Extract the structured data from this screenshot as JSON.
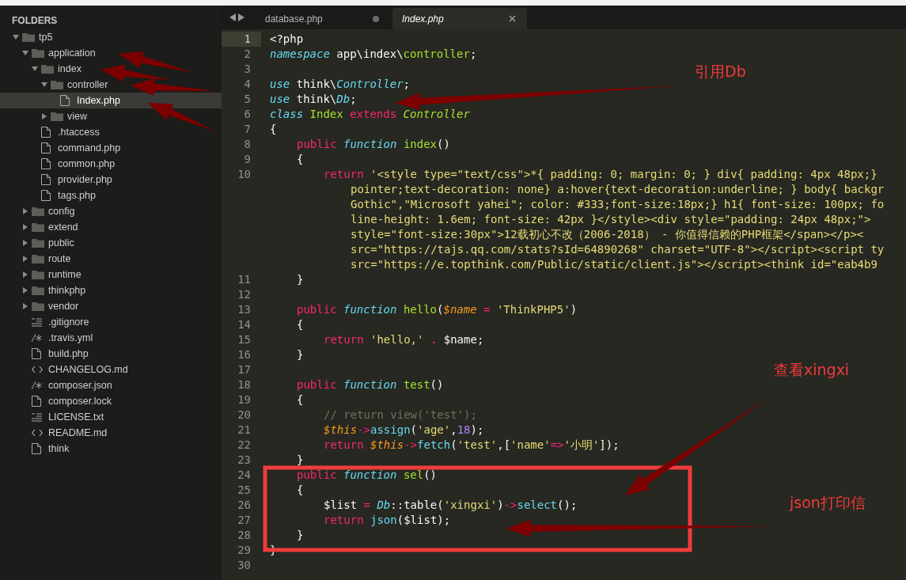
{
  "sidebar": {
    "header": "FOLDERS",
    "items": [
      {
        "label": "tp5",
        "kind": "folder",
        "expanded": true,
        "selected": false,
        "children": [
          {
            "label": "application",
            "kind": "folder",
            "expanded": true,
            "selected": false,
            "children": [
              {
                "label": "index",
                "kind": "folder",
                "expanded": true,
                "selected": false,
                "children": [
                  {
                    "label": "controller",
                    "kind": "folder",
                    "expanded": true,
                    "selected": false,
                    "children": [
                      {
                        "label": "Index.php",
                        "kind": "file",
                        "selected": true
                      }
                    ]
                  },
                  {
                    "label": "view",
                    "kind": "folder",
                    "expanded": false,
                    "selected": false
                  }
                ]
              },
              {
                "label": ".htaccess",
                "kind": "file",
                "selected": false
              },
              {
                "label": "command.php",
                "kind": "file",
                "selected": false
              },
              {
                "label": "common.php",
                "kind": "file",
                "selected": false
              },
              {
                "label": "provider.php",
                "kind": "file",
                "selected": false
              },
              {
                "label": "tags.php",
                "kind": "file",
                "selected": false
              }
            ]
          },
          {
            "label": "config",
            "kind": "folder",
            "expanded": false,
            "selected": false
          },
          {
            "label": "extend",
            "kind": "folder",
            "expanded": false,
            "selected": false
          },
          {
            "label": "public",
            "kind": "folder",
            "expanded": false,
            "selected": false
          },
          {
            "label": "route",
            "kind": "folder",
            "expanded": false,
            "selected": false
          },
          {
            "label": "runtime",
            "kind": "folder",
            "expanded": false,
            "selected": false
          },
          {
            "label": "thinkphp",
            "kind": "folder",
            "expanded": false,
            "selected": false
          },
          {
            "label": "vendor",
            "kind": "folder",
            "expanded": false,
            "selected": false
          },
          {
            "label": ".gitignore",
            "kind": "text",
            "selected": false
          },
          {
            "label": ".travis.yml",
            "kind": "comment",
            "selected": false
          },
          {
            "label": "build.php",
            "kind": "file",
            "selected": false
          },
          {
            "label": "CHANGELOG.md",
            "kind": "markup",
            "selected": false
          },
          {
            "label": "composer.json",
            "kind": "comment",
            "selected": false
          },
          {
            "label": "composer.lock",
            "kind": "file",
            "selected": false
          },
          {
            "label": "LICENSE.txt",
            "kind": "text",
            "selected": false
          },
          {
            "label": "README.md",
            "kind": "markup",
            "selected": false
          },
          {
            "label": "think",
            "kind": "file",
            "selected": false
          }
        ]
      }
    ]
  },
  "tabs": [
    {
      "label": "database.php",
      "selected": false,
      "modified": true
    },
    {
      "label": "Index.php",
      "selected": true,
      "modified": false
    }
  ],
  "editor": {
    "lines": [
      {
        "number": "1",
        "current": true,
        "kind": "top",
        "segments": [
          {
            "kind": "plain",
            "text": "<?php"
          }
        ]
      },
      {
        "number": "2",
        "current": false,
        "kind": "top",
        "segments": [
          {
            "kind": "storage",
            "text": "namespace "
          },
          {
            "kind": "plain",
            "text": "app\\index\\"
          },
          {
            "kind": "entity",
            "text": "controller"
          },
          {
            "kind": "plain",
            "text": ";"
          }
        ]
      },
      {
        "number": "3",
        "current": false
      },
      {
        "number": "4",
        "current": false,
        "kind": "top",
        "segments": [
          {
            "kind": "storage",
            "text": "use "
          },
          {
            "kind": "plain",
            "text": "think\\"
          },
          {
            "kind": "support_italic",
            "text": "Controller"
          },
          {
            "kind": "plain",
            "text": ";"
          }
        ]
      },
      {
        "number": "5",
        "current": false,
        "kind": "top",
        "segments": [
          {
            "kind": "storage",
            "text": "use "
          },
          {
            "kind": "plain",
            "text": "think\\"
          },
          {
            "kind": "support_italic",
            "text": "Db"
          },
          {
            "kind": "plain",
            "text": ";"
          }
        ]
      },
      {
        "number": "6",
        "current": false,
        "kind": "top",
        "segments": [
          {
            "kind": "storage",
            "text": "class "
          },
          {
            "kind": "entity",
            "text": "Index "
          },
          {
            "kind": "keyword",
            "text": "extends "
          },
          {
            "kind": "inherited",
            "text": "Controller"
          }
        ]
      },
      {
        "number": "7",
        "current": false,
        "kind": "top",
        "segments": [
          {
            "kind": "plain",
            "text": "{"
          }
        ]
      },
      {
        "number": "8",
        "current": false,
        "kind": "method",
        "segments": [
          {
            "kind": "keyword",
            "text": "public "
          },
          {
            "kind": "storage",
            "text": "function "
          },
          {
            "kind": "entity",
            "text": "index"
          },
          {
            "kind": "plain",
            "text": "()"
          }
        ]
      },
      {
        "number": "9",
        "current": false,
        "kind": "method",
        "segments": [
          {
            "kind": "plain",
            "text": "{"
          }
        ]
      },
      {
        "number": "10",
        "current": false,
        "kind": "statement",
        "segments": [
          {
            "kind": "keyword",
            "text": "return "
          },
          {
            "kind": "string",
            "text": "'<style type=\"text/css\">*{ padding: 0; margin: 0; } div{ padding: 4px 48px;}"
          }
        ],
        "wrapped": [
          [
            {
              "kind": "string",
              "text": "pointer;text-decoration: none} a:hover{text-decoration:underline; } body{ backgr"
            }
          ],
          [
            {
              "kind": "string",
              "text": "Gothic\",\"Microsoft yahei\"; color: #333;font-size:18px;} h1{ font-size: 100px; fo"
            }
          ],
          [
            {
              "kind": "string",
              "text": "line-height: 1.6em; font-size: 42px }</style><div style=\"padding: 24px 48px;\">"
            }
          ],
          [
            {
              "kind": "string",
              "text": "style=\"font-size:30px\">12载初心不改（2006-2018） - 你值得信赖的PHP框架</span></p><"
            }
          ],
          [
            {
              "kind": "string",
              "text": "src=\"https://tajs.qq.com/stats?sId=64890268\" charset=\"UTF-8\"></script><script ty"
            }
          ],
          [
            {
              "kind": "string",
              "text": "src=\"https://e.topthink.com/Public/static/client.js\"></script><think id=\"eab4b9"
            }
          ]
        ]
      },
      {
        "number": "11",
        "current": false,
        "kind": "method",
        "segments": [
          {
            "kind": "plain",
            "text": "}"
          }
        ]
      },
      {
        "number": "12",
        "current": false
      },
      {
        "number": "13",
        "current": false,
        "kind": "method",
        "segments": [
          {
            "kind": "keyword",
            "text": "public "
          },
          {
            "kind": "storage",
            "text": "function "
          },
          {
            "kind": "entity",
            "text": "hello"
          },
          {
            "kind": "plain",
            "text": "("
          },
          {
            "kind": "variable",
            "text": "$name "
          },
          {
            "kind": "keyword",
            "text": "= "
          },
          {
            "kind": "string",
            "text": "'ThinkPHP5'"
          },
          {
            "kind": "plain",
            "text": ")"
          }
        ]
      },
      {
        "number": "14",
        "current": false,
        "kind": "method",
        "segments": [
          {
            "kind": "plain",
            "text": "{"
          }
        ]
      },
      {
        "number": "15",
        "current": false,
        "kind": "statement",
        "segments": [
          {
            "kind": "keyword",
            "text": "return "
          },
          {
            "kind": "string",
            "text": "'hello,' "
          },
          {
            "kind": "keyword",
            "text": ". "
          },
          {
            "kind": "plain",
            "text": "$name;"
          }
        ]
      },
      {
        "number": "16",
        "current": false,
        "kind": "method",
        "segments": [
          {
            "kind": "plain",
            "text": "}"
          }
        ]
      },
      {
        "number": "17",
        "current": false
      },
      {
        "number": "18",
        "current": false,
        "kind": "method",
        "segments": [
          {
            "kind": "keyword",
            "text": "public "
          },
          {
            "kind": "storage",
            "text": "function "
          },
          {
            "kind": "entity",
            "text": "test"
          },
          {
            "kind": "plain",
            "text": "()"
          }
        ]
      },
      {
        "number": "19",
        "current": false,
        "kind": "method",
        "segments": [
          {
            "kind": "plain",
            "text": "{"
          }
        ]
      },
      {
        "number": "20",
        "current": false,
        "kind": "statement",
        "segments": [
          {
            "kind": "comment",
            "text": "// return view('test');"
          }
        ]
      },
      {
        "number": "21",
        "current": false,
        "kind": "statement",
        "segments": [
          {
            "kind": "variable",
            "text": "$this"
          },
          {
            "kind": "keyword",
            "text": "->"
          },
          {
            "kind": "support",
            "text": "assign"
          },
          {
            "kind": "plain",
            "text": "("
          },
          {
            "kind": "string",
            "text": "'age'"
          },
          {
            "kind": "plain",
            "text": ","
          },
          {
            "kind": "number",
            "text": "18"
          },
          {
            "kind": "plain",
            "text": ");"
          }
        ]
      },
      {
        "number": "22",
        "current": false,
        "kind": "statement",
        "segments": [
          {
            "kind": "keyword",
            "text": "return "
          },
          {
            "kind": "variable",
            "text": "$this"
          },
          {
            "kind": "keyword",
            "text": "->"
          },
          {
            "kind": "support",
            "text": "fetch"
          },
          {
            "kind": "plain",
            "text": "("
          },
          {
            "kind": "string",
            "text": "'test'"
          },
          {
            "kind": "plain",
            "text": ",["
          },
          {
            "kind": "string",
            "text": "'name'"
          },
          {
            "kind": "keyword",
            "text": "=>"
          },
          {
            "kind": "string",
            "text": "'小明'"
          },
          {
            "kind": "plain",
            "text": "]);"
          }
        ]
      },
      {
        "number": "23",
        "current": false,
        "kind": "method",
        "segments": [
          {
            "kind": "plain",
            "text": "}"
          }
        ]
      },
      {
        "number": "24",
        "current": false,
        "kind": "method",
        "segments": [
          {
            "kind": "keyword",
            "text": "public "
          },
          {
            "kind": "storage",
            "text": "function "
          },
          {
            "kind": "entity",
            "text": "sel"
          },
          {
            "kind": "plain",
            "text": "()"
          }
        ]
      },
      {
        "number": "25",
        "current": false,
        "kind": "method",
        "segments": [
          {
            "kind": "plain",
            "text": "{"
          }
        ]
      },
      {
        "number": "26",
        "current": false,
        "kind": "statement",
        "segments": [
          {
            "kind": "plain",
            "text": "$list "
          },
          {
            "kind": "keyword",
            "text": "= "
          },
          {
            "kind": "support_italic",
            "text": "Db"
          },
          {
            "kind": "plain",
            "text": "::table("
          },
          {
            "kind": "string",
            "text": "'xingxi'"
          },
          {
            "kind": "plain",
            "text": ")"
          },
          {
            "kind": "keyword",
            "text": "->"
          },
          {
            "kind": "support",
            "text": "select"
          },
          {
            "kind": "plain",
            "text": "();"
          }
        ]
      },
      {
        "number": "27",
        "current": false,
        "kind": "statement",
        "segments": [
          {
            "kind": "keyword",
            "text": "return "
          },
          {
            "kind": "support",
            "text": "json"
          },
          {
            "kind": "plain",
            "text": "($list);"
          }
        ]
      },
      {
        "number": "28",
        "current": false,
        "kind": "method",
        "segments": [
          {
            "kind": "plain",
            "text": "}"
          }
        ]
      },
      {
        "number": "29",
        "current": false,
        "kind": "top",
        "segments": [
          {
            "kind": "plain",
            "text": "}"
          }
        ]
      },
      {
        "number": "30",
        "current": false
      }
    ]
  },
  "annotations": [
    {
      "text": "引用Db"
    },
    {
      "text": "查看xingxi"
    },
    {
      "text": "json打印信"
    }
  ]
}
